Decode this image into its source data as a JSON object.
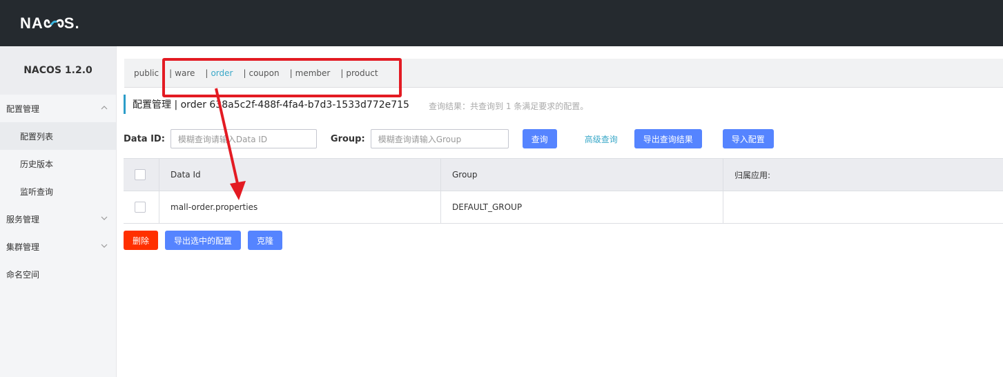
{
  "header": {
    "logo_pre": "NA",
    "logo_post": "S"
  },
  "sidebar": {
    "version": "NACOS 1.2.0",
    "items": [
      {
        "label": "配置管理",
        "type": "group",
        "expanded": true
      },
      {
        "label": "配置列表",
        "type": "sub",
        "active": true
      },
      {
        "label": "历史版本",
        "type": "sub"
      },
      {
        "label": "监听查询",
        "type": "sub"
      },
      {
        "label": "服务管理",
        "type": "group",
        "expanded": false
      },
      {
        "label": "集群管理",
        "type": "group",
        "expanded": false
      },
      {
        "label": "命名空间",
        "type": "plain"
      }
    ]
  },
  "namespaces": {
    "items": [
      "public",
      "ware",
      "order",
      "coupon",
      "member",
      "product"
    ],
    "separator": "|",
    "active": "order"
  },
  "breadcrumb": {
    "text": "配置管理 | order 638a5c2f-488f-4fa4-b7d3-1533d772e715",
    "hint": "查询结果：共查询到 1 条满足要求的配置。"
  },
  "search": {
    "dataid_label": "Data ID:",
    "dataid_placeholder": "模糊查询请输入Data ID",
    "group_label": "Group:",
    "group_placeholder": "模糊查询请输入Group",
    "query_button": "查询",
    "advanced_link": "高级查询",
    "export_button": "导出查询结果",
    "import_button": "导入配置"
  },
  "table": {
    "headers": [
      "Data Id",
      "Group",
      "归属应用:"
    ],
    "rows": [
      {
        "data_id": "mall-order.properties",
        "group": "DEFAULT_GROUP",
        "app": ""
      }
    ]
  },
  "actions": {
    "delete": "删除",
    "export_selected": "导出选中的配置",
    "clone": "克隆"
  },
  "colors": {
    "annotation": "#e31b23",
    "primary": "#5584ff",
    "danger": "#ff3000",
    "accent": "#3aa8c8"
  }
}
